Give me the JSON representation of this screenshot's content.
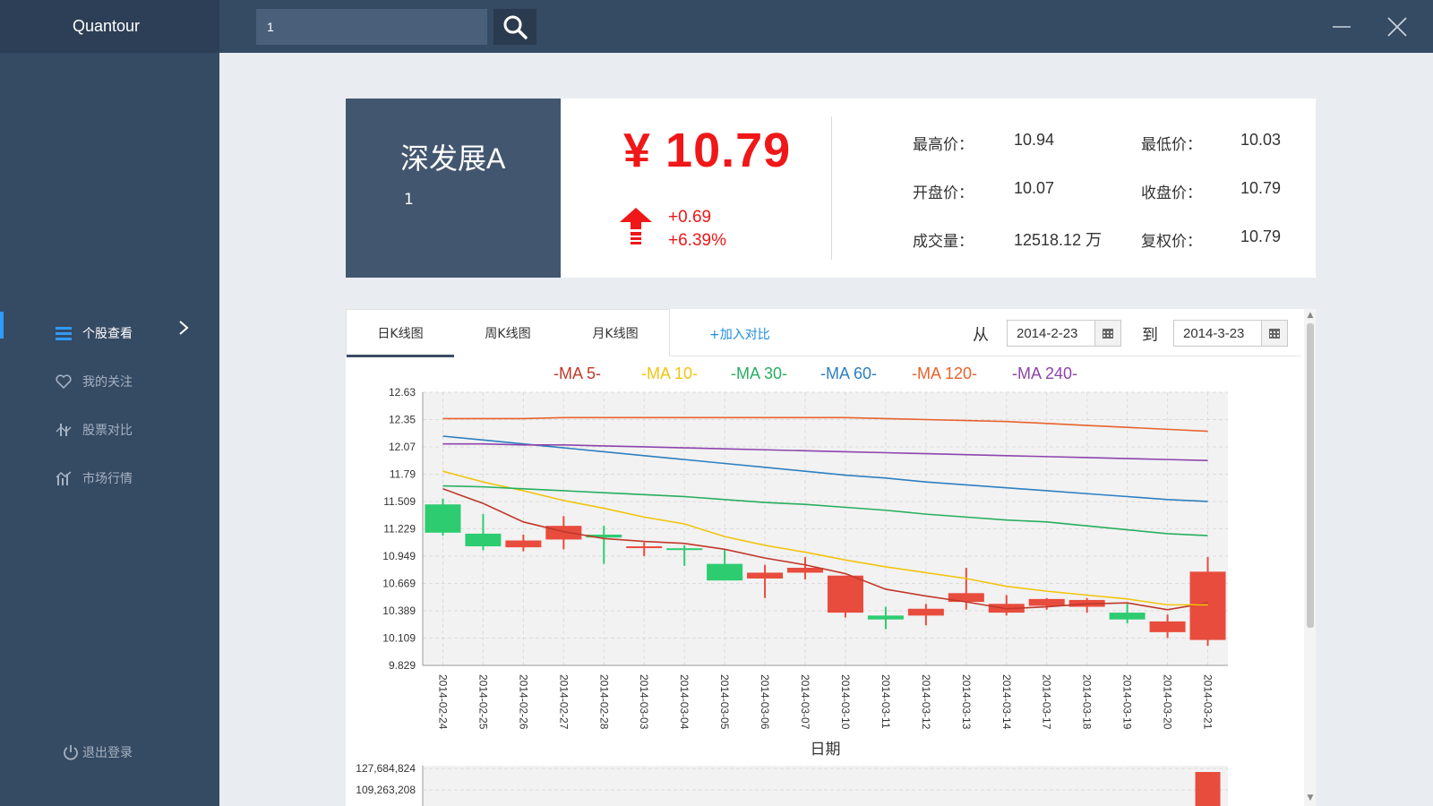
{
  "app": {
    "brand": "Quantour"
  },
  "search": {
    "value": "1"
  },
  "sidebar": {
    "items": [
      {
        "label": "个股查看",
        "icon": "list-icon",
        "active": true
      },
      {
        "label": "我的关注",
        "icon": "heart-icon",
        "active": false
      },
      {
        "label": "股票对比",
        "icon": "compare-icon",
        "active": false
      },
      {
        "label": "市场行情",
        "icon": "market-chart-icon",
        "active": false
      }
    ],
    "logout": "退出登录"
  },
  "stock": {
    "name": "深发展A",
    "code": "1",
    "price": "¥ 10.79",
    "change_abs": "+0.69",
    "change_pct": "+6.39%",
    "stats": {
      "high_label": "最高价：",
      "high": "10.94",
      "low_label": "最低价：",
      "low": "10.03",
      "open_label": "开盘价：",
      "open": "10.07",
      "close_label": "收盘价：",
      "close": "10.79",
      "volume_label": "成交量：",
      "volume": "12518.12 万",
      "adj_label": "复权价：",
      "adj": "10.79"
    }
  },
  "chart_panel": {
    "tabs": [
      "日K线图",
      "周K线图",
      "月K线图"
    ],
    "active_tab": 0,
    "add_compare": "+加入对比",
    "from_label": "从",
    "to_label": "到",
    "from_date": "2014-2-23",
    "to_date": "2014-3-23"
  },
  "colors": {
    "up": "#e84c3d",
    "down": "#2ecc71",
    "accent": "#2f9bff",
    "price": "#ef1717"
  },
  "chart_data": {
    "type": "candlestick",
    "xlabel": "日期",
    "ylim": [
      9.829,
      12.63
    ],
    "yticks": [
      "12.63",
      "12.35",
      "12.07",
      "11.79",
      "11.509",
      "11.229",
      "10.949",
      "10.669",
      "10.389",
      "10.109",
      "9.829"
    ],
    "dates": [
      "2014-02-24",
      "2014-02-25",
      "2014-02-26",
      "2014-02-27",
      "2014-02-28",
      "2014-03-03",
      "2014-03-04",
      "2014-03-05",
      "2014-03-06",
      "2014-03-07",
      "2014-03-10",
      "2014-03-11",
      "2014-03-12",
      "2014-03-13",
      "2014-03-14",
      "2014-03-17",
      "2014-03-18",
      "2014-03-19",
      "2014-03-20",
      "2014-03-21"
    ],
    "ohlc": [
      [
        11.48,
        11.54,
        11.16,
        11.19
      ],
      [
        11.18,
        11.38,
        11.01,
        11.05
      ],
      [
        11.04,
        11.17,
        11.0,
        11.11
      ],
      [
        11.12,
        11.36,
        11.02,
        11.26
      ],
      [
        11.17,
        11.26,
        10.87,
        11.14
      ],
      [
        11.04,
        11.09,
        10.95,
        11.05
      ],
      [
        11.03,
        11.06,
        10.85,
        11.02
      ],
      [
        10.87,
        11.02,
        10.74,
        10.7
      ],
      [
        10.72,
        10.86,
        10.52,
        10.78
      ],
      [
        10.78,
        10.94,
        10.71,
        10.83
      ],
      [
        10.37,
        10.75,
        10.32,
        10.75
      ],
      [
        10.34,
        10.43,
        10.2,
        10.3
      ],
      [
        10.34,
        10.46,
        10.24,
        10.41
      ],
      [
        10.48,
        10.83,
        10.4,
        10.57
      ],
      [
        10.37,
        10.55,
        10.34,
        10.46
      ],
      [
        10.44,
        10.52,
        10.4,
        10.51
      ],
      [
        10.43,
        10.52,
        10.37,
        10.5
      ],
      [
        10.37,
        10.46,
        10.26,
        10.3
      ],
      [
        10.17,
        10.35,
        10.11,
        10.28
      ],
      [
        10.09,
        10.94,
        10.03,
        10.79
      ]
    ],
    "ma_series": [
      {
        "name": "-MA 5-",
        "color": "#c0392b",
        "values": [
          11.64,
          11.49,
          11.3,
          11.2,
          11.13,
          11.1,
          11.08,
          11.02,
          10.93,
          10.86,
          10.77,
          10.61,
          10.54,
          10.48,
          10.41,
          10.43,
          10.46,
          10.47,
          10.4,
          10.47
        ]
      },
      {
        "name": "-MA 10-",
        "color": "#f1c40f",
        "values": [
          11.82,
          11.71,
          11.62,
          11.52,
          11.44,
          11.35,
          11.28,
          11.15,
          11.06,
          10.99,
          10.91,
          10.84,
          10.78,
          10.72,
          10.64,
          10.59,
          10.55,
          10.51,
          10.45,
          10.45
        ]
      },
      {
        "name": "-MA 30-",
        "color": "#27ae60",
        "values": [
          11.67,
          11.66,
          11.64,
          11.62,
          11.6,
          11.58,
          11.56,
          11.53,
          11.5,
          11.48,
          11.45,
          11.42,
          11.38,
          11.35,
          11.32,
          11.3,
          11.26,
          11.22,
          11.18,
          11.16
        ]
      },
      {
        "name": "-MA 60-",
        "color": "#2d7fc1",
        "values": [
          12.18,
          12.14,
          12.1,
          12.06,
          12.02,
          11.98,
          11.94,
          11.9,
          11.86,
          11.82,
          11.78,
          11.75,
          11.71,
          11.68,
          11.65,
          11.62,
          11.59,
          11.56,
          11.53,
          11.51
        ]
      },
      {
        "name": "-MA 120-",
        "color": "#e8632c",
        "values": [
          12.36,
          12.36,
          12.36,
          12.37,
          12.37,
          12.37,
          12.37,
          12.37,
          12.37,
          12.37,
          12.37,
          12.36,
          12.35,
          12.34,
          12.33,
          12.31,
          12.29,
          12.27,
          12.25,
          12.23
        ]
      },
      {
        "name": "-MA 240-",
        "color": "#8e44ad",
        "values": [
          12.1,
          12.1,
          12.09,
          12.09,
          12.08,
          12.07,
          12.06,
          12.05,
          12.04,
          12.03,
          12.02,
          12.01,
          12.0,
          11.99,
          11.98,
          11.97,
          11.96,
          11.95,
          11.94,
          11.93
        ]
      }
    ],
    "volume": {
      "yticks": [
        "127,684,824",
        "109,263,208"
      ]
    }
  }
}
